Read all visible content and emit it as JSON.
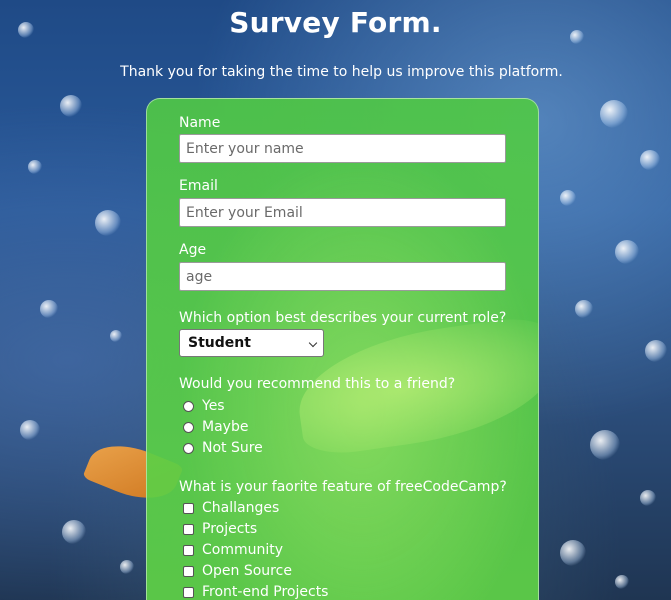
{
  "header": {
    "title": "Survey Form.",
    "description": "Thank you for taking the time to help us improve this platform."
  },
  "form": {
    "name": {
      "label": "Name",
      "placeholder": "Enter your name"
    },
    "email": {
      "label": "Email",
      "placeholder": "Enter your Email"
    },
    "age": {
      "label": "Age",
      "placeholder": "age"
    },
    "role": {
      "label": "Which option best describes your current role?",
      "selected": "Student"
    },
    "recommend": {
      "label": "Would you recommend this to a friend?",
      "options": [
        "Yes",
        "Maybe",
        "Not Sure"
      ]
    },
    "feature": {
      "label": "What is your faorite feature of freeCodeCamp?",
      "options": [
        "Challanges",
        "Projects",
        "Community",
        "Open Source",
        "Front-end Projects"
      ]
    }
  },
  "colors": {
    "card_green": "#5ccf47",
    "background_blue": "#2a5a9a"
  }
}
